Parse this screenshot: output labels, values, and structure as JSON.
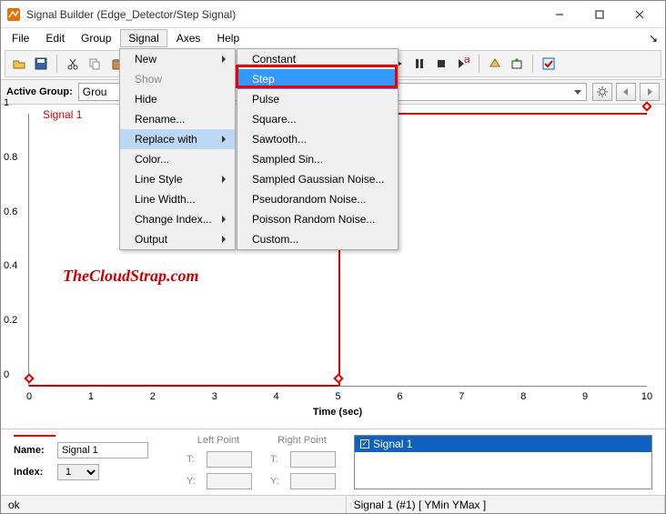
{
  "window": {
    "title": "Signal Builder (Edge_Detector/Step Signal)"
  },
  "menubar": [
    "File",
    "Edit",
    "Group",
    "Signal",
    "Axes",
    "Help"
  ],
  "active_menu_index": 3,
  "signal_menu": {
    "items": [
      {
        "label": "New",
        "arrow": true
      },
      {
        "label": "Show",
        "disabled": true
      },
      {
        "label": "Hide"
      },
      {
        "label": "Rename..."
      },
      {
        "label": "Replace with",
        "arrow": true,
        "hi": true
      },
      {
        "label": "Color..."
      },
      {
        "label": "Line Style",
        "arrow": true
      },
      {
        "label": "Line Width..."
      },
      {
        "label": "Change Index...",
        "arrow": true
      },
      {
        "label": "Output",
        "arrow": true
      }
    ]
  },
  "replace_submenu": {
    "items": [
      {
        "label": "Constant"
      },
      {
        "label": "Step",
        "hi": true
      },
      {
        "label": "Pulse"
      },
      {
        "label": "Square..."
      },
      {
        "label": "Sawtooth..."
      },
      {
        "label": "Sampled Sin..."
      },
      {
        "label": "Sampled Gaussian Noise..."
      },
      {
        "label": "Pseudorandom Noise..."
      },
      {
        "label": "Poisson Random Noise..."
      },
      {
        "label": "Custom..."
      }
    ]
  },
  "active_group": {
    "label": "Active Group:",
    "value": "Grou"
  },
  "plot": {
    "signal_label": "Signal 1",
    "yticks": [
      "0",
      "0.2",
      "0.4",
      "0.6",
      "0.8",
      "1"
    ],
    "xticks": [
      "0",
      "1",
      "2",
      "3",
      "4",
      "5",
      "6",
      "7",
      "8",
      "9",
      "10"
    ],
    "xlabel": "Time (sec)"
  },
  "watermark": "TheCloudStrap.com",
  "bottom": {
    "left_point": "Left Point",
    "right_point": "Right Point",
    "name_label": "Name:",
    "name_value": "Signal 1",
    "index_label": "Index:",
    "index_value": "1",
    "t_label": "T:",
    "y_label": "Y:",
    "list_item": "Signal 1"
  },
  "status": {
    "left": "ok",
    "right": "Signal 1 (#1)  [ YMin YMax ]"
  },
  "chart_data": {
    "type": "line",
    "title": "Signal 1",
    "xlabel": "Time (sec)",
    "ylabel": "",
    "xlim": [
      0,
      10
    ],
    "ylim": [
      0,
      1
    ],
    "series": [
      {
        "name": "Signal 1",
        "x": [
          0,
          5,
          5,
          10
        ],
        "y": [
          0,
          0,
          1,
          1
        ],
        "color": "#d00000"
      }
    ]
  }
}
